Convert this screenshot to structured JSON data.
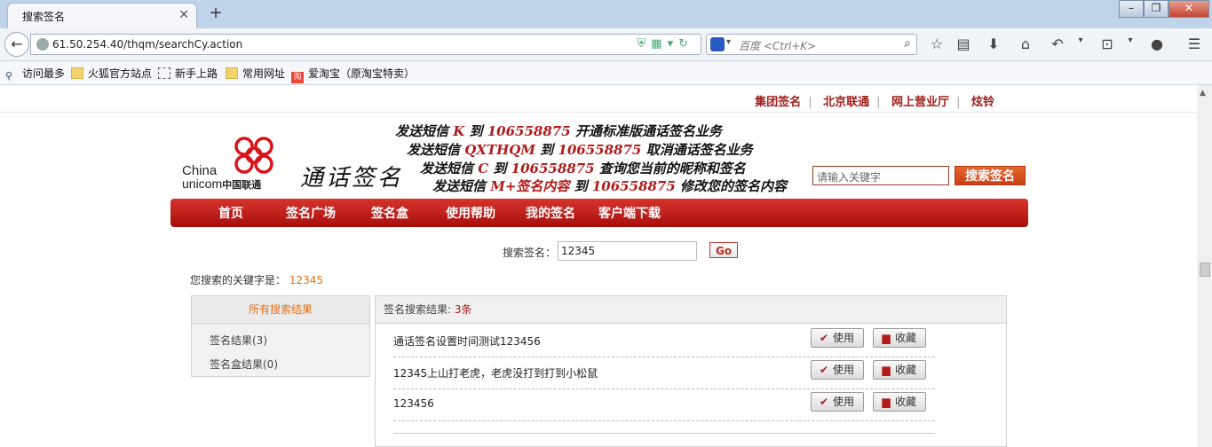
{
  "browser": {
    "tab_title": "搜索签名",
    "tab_close": "✕",
    "new_tab": "+",
    "url": "61.50.254.40/thqm/searchCy.action",
    "search_placeholder": "百度 <Ctrl+K>",
    "window_controls": [
      "–",
      "❐",
      "✕"
    ],
    "bookmarks": [
      "访问最多",
      "火狐官方站点",
      "新手上路",
      "常用网址",
      "爱淘宝（原淘宝特卖）"
    ]
  },
  "site": {
    "top_links": [
      "集团签名",
      "北京联通",
      "网上营业厅",
      "炫铃"
    ],
    "logo": {
      "china": "China",
      "unicom": "unicom",
      "unicom_cn": "中国联通"
    },
    "calligraphy": "通话签名",
    "sms_lines": [
      {
        "a": "发送短信 ",
        "code": "K",
        "b": " 到 ",
        "num": "106558875",
        "c": " 开通标准版通话签名业务"
      },
      {
        "a": "发送短信 ",
        "code": "QXTHQM",
        "b": " 到 ",
        "num": "106558875",
        "c": " 取消通话签名业务"
      },
      {
        "a": "发送短信 ",
        "code": "C",
        "b": " 到 ",
        "num": "106558875",
        "c": " 查询您当前的昵称和签名"
      },
      {
        "a": "发送短信 ",
        "code": "M+签名内容",
        "b": " 到 ",
        "num": "106558875",
        "c": " 修改您的签名内容"
      }
    ],
    "header_search_placeholder": "请输入关键字",
    "header_search_button": "搜索签名",
    "nav": [
      "首页",
      "签名广场",
      "签名盒",
      "使用帮助",
      "我的签名",
      "客户端下载"
    ]
  },
  "search": {
    "label": "搜索签名：",
    "value": "12345",
    "go": "Go",
    "keyword_prefix": "您搜索的关键字是：",
    "keyword": "12345"
  },
  "left_panel": {
    "header": "所有搜索结果",
    "items": [
      "签名结果(3)",
      "签名盒结果(0)"
    ]
  },
  "results": {
    "header_prefix": "签名搜索结果: ",
    "count": "3条",
    "use_label": "使用",
    "fav_label": "收藏",
    "rows": [
      "通话签名设置时间测试123456",
      "12345上山打老虎，老虎没打到打到小松鼠",
      "123456"
    ]
  },
  "colors": {
    "brand_red": "#b11a1a",
    "accent_orange": "#e0711c",
    "nav_red": "#c4201c"
  }
}
